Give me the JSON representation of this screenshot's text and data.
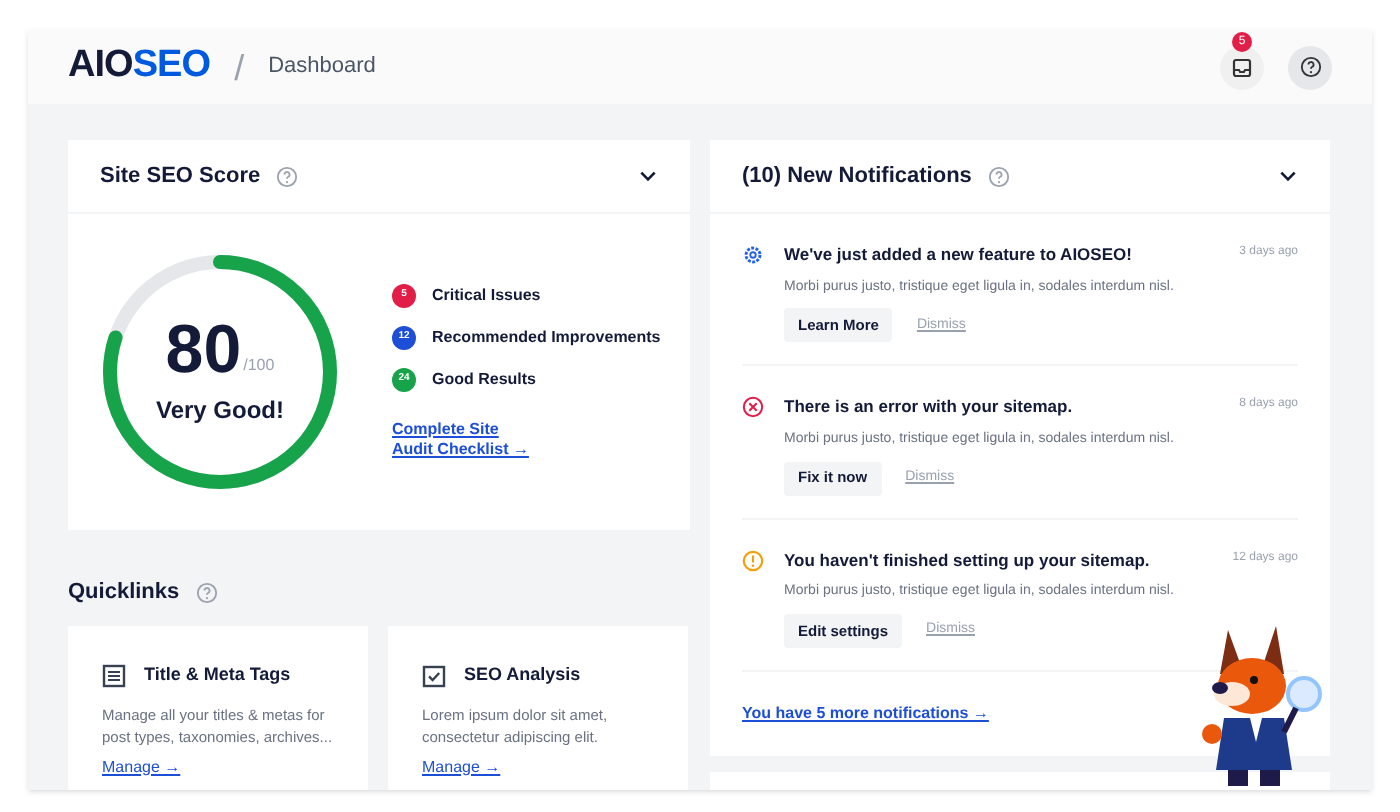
{
  "header": {
    "logo": {
      "text_dark": "AIO",
      "text_blue": "SE",
      "text_blue_end": "O"
    },
    "separator": "/",
    "breadcrumb": "Dashboard",
    "notification_count": "5"
  },
  "seo_score": {
    "title": "Site SEO Score",
    "expanded": true,
    "score": "80",
    "max": "/100",
    "level": 0.8,
    "rating": "Very Good!",
    "results": [
      {
        "count": "5",
        "label": "Critical Issues",
        "color": "#e11d48"
      },
      {
        "count": "12",
        "label": "Recommended Improvements",
        "color": "#1d4ed8"
      },
      {
        "count": "24",
        "label": "Good Results",
        "color": "#16a34a"
      }
    ],
    "link_lines": [
      "Complete Site",
      "Audit Checklist →"
    ]
  },
  "quicklinks": {
    "title": "Quicklinks",
    "cards": [
      {
        "kind": "list",
        "title": "Title & Meta Tags",
        "description": "Manage all your titles & metas for post types, taxonomies, archives...",
        "link": "Manage →"
      },
      {
        "kind": "check",
        "title": "SEO Analysis",
        "description": "Lorem ipsum dolor sit amet, consectetur adipiscing elit.",
        "link": "Manage →"
      }
    ]
  },
  "notifications": {
    "title": "(10) New Notifications",
    "expanded": true,
    "items": [
      {
        "kind": "info",
        "title": "We've just added a new feature to AIOSEO!",
        "time": "3 days ago",
        "body": "Morbi purus justo, tristique eget ligula in, sodales interdum nisl.",
        "action": "Learn More",
        "dismiss": "Dismiss"
      },
      {
        "kind": "error",
        "title": "There is an error with your sitemap.",
        "time": "8 days ago",
        "body": "Morbi purus justo, tristique eget ligula in, sodales interdum nisl.",
        "action": "Fix it now",
        "dismiss": "Dismiss"
      },
      {
        "kind": "warning",
        "title": "You haven't finished setting up your sitemap.",
        "time": "12 days ago",
        "body": "Morbi purus justo, tristique eget ligula in, sodales interdum nisl.",
        "action": "Edit settings",
        "dismiss": "Dismiss"
      }
    ],
    "more_link": "You have 5 more notifications →"
  }
}
